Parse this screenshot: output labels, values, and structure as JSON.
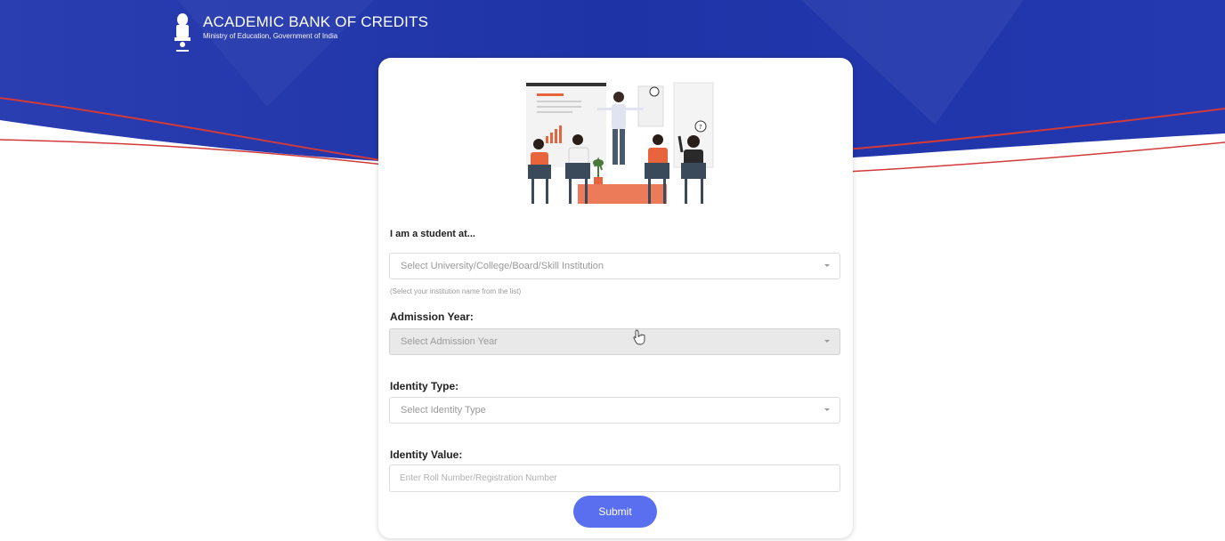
{
  "header": {
    "title": "ACADEMIC BANK OF CREDITS",
    "subtitle": "Ministry of Education, Government of India"
  },
  "form": {
    "institution": {
      "label": "I am a student at...",
      "placeholder": "Select University/College/Board/Skill Institution",
      "helper": "(Select your institution name from the list)"
    },
    "admission_year": {
      "label": "Admission Year:",
      "placeholder": "Select Admission Year",
      "disabled": true
    },
    "identity_type": {
      "label": "Identity Type:",
      "placeholder": "Select Identity Type"
    },
    "identity_value": {
      "label": "Identity Value:",
      "placeholder": "Enter Roll Number/Registration Number"
    },
    "submit_label": "Submit"
  },
  "colors": {
    "banner_blue": "#1f36a8",
    "accent_red": "#d23a3a",
    "submit_button": "#5a6ef0",
    "illustration_orange": "#e8643c"
  },
  "icons": {
    "emblem": "national-emblem-icon",
    "dropdown": "chevron-down-icon",
    "cursor": "hand-pointer-icon"
  }
}
